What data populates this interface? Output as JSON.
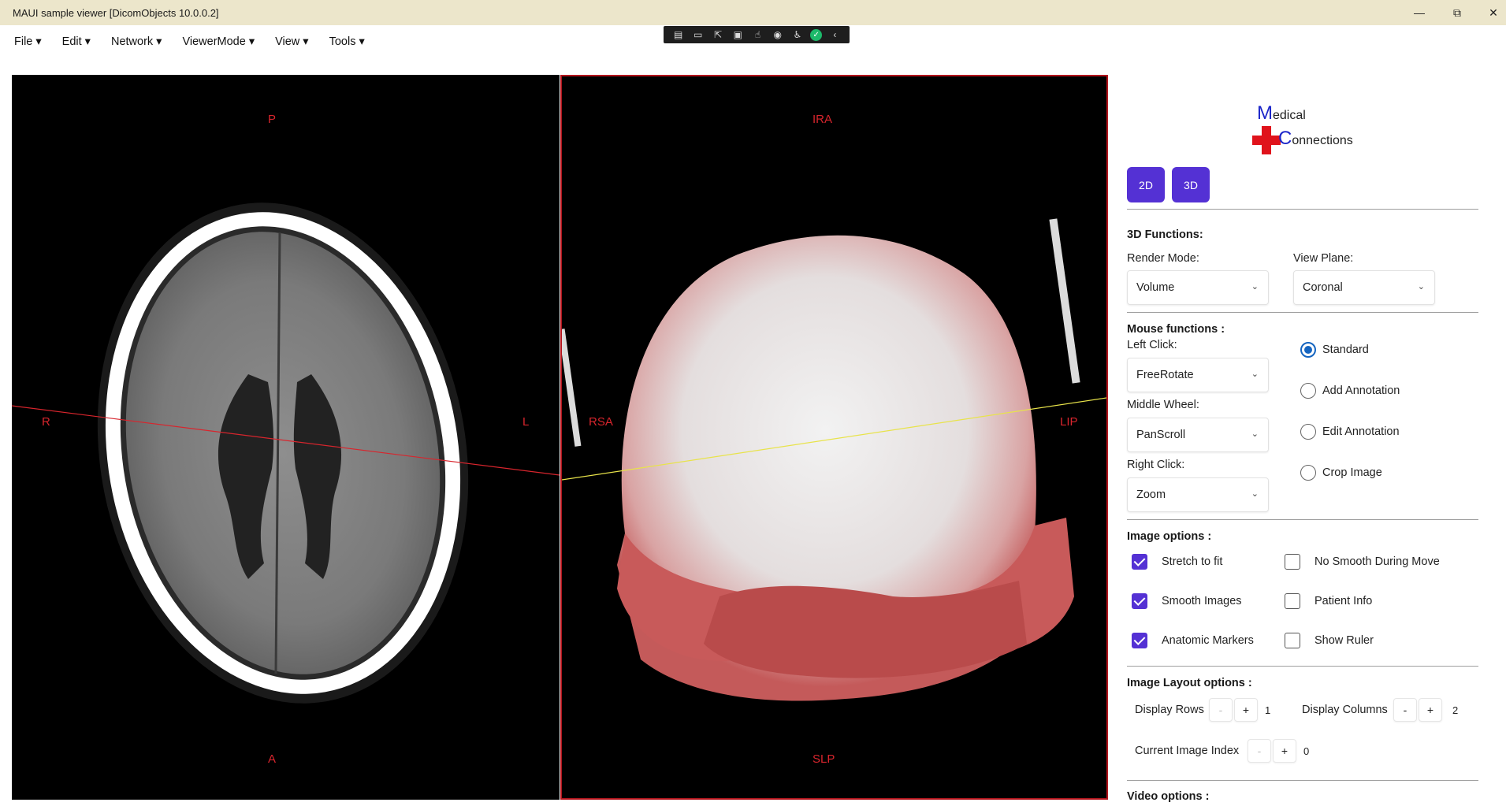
{
  "window": {
    "title": "MAUI sample viewer  [DicomObjects 10.0.0.2]",
    "minimize": "—",
    "restore": "⧉",
    "close": "✕"
  },
  "menu": [
    "File ▾",
    "Edit ▾",
    "Network ▾",
    "ViewerMode ▾",
    "View ▾",
    "Tools ▾"
  ],
  "floating_toolbar": {
    "icons": [
      "grid-icon",
      "camera-icon",
      "cursor-icon",
      "frame-icon",
      "touch-icon",
      "wave-icon",
      "accessibility-icon",
      "check-icon",
      "chevron-left-icon"
    ],
    "collapse": "‹"
  },
  "viewer_2d": {
    "markers": {
      "top": "P",
      "bottom": "A",
      "left": "R",
      "right": "L"
    }
  },
  "viewer_3d": {
    "markers": {
      "top": "IRA",
      "bottom": "SLP",
      "left": "RSA",
      "right": "LIP"
    }
  },
  "logo": {
    "line1_initial": "M",
    "line1_rest": "edical",
    "line2_initial": "C",
    "line2_rest": "onnections"
  },
  "panel": {
    "mode_buttons": [
      "2D",
      "3D"
    ],
    "functions_3d": {
      "heading": "3D Functions:",
      "render_mode_label": "Render Mode:",
      "render_mode_value": "Volume",
      "view_plane_label": "View Plane:",
      "view_plane_value": "Coronal"
    },
    "mouse": {
      "heading": "Mouse functions :",
      "left_label": "Left Click:",
      "left_value": "FreeRotate",
      "middle_label": "Middle Wheel:",
      "middle_value": "PanScroll",
      "right_label": "Right Click:",
      "right_value": "Zoom",
      "radios": [
        {
          "label": "Standard",
          "selected": true
        },
        {
          "label": "Add Annotation",
          "selected": false
        },
        {
          "label": "Edit Annotation",
          "selected": false
        },
        {
          "label": "Crop Image",
          "selected": false
        }
      ]
    },
    "image_options": {
      "heading": "Image options :",
      "checks": [
        {
          "label": "Stretch to fit",
          "checked": true
        },
        {
          "label": "No Smooth During Move",
          "checked": false
        },
        {
          "label": "Smooth Images",
          "checked": true
        },
        {
          "label": "Patient Info",
          "checked": false
        },
        {
          "label": "Anatomic Markers",
          "checked": true
        },
        {
          "label": "Show Ruler",
          "checked": false
        }
      ]
    },
    "layout": {
      "heading": "Image Layout options :",
      "rows_label": "Display Rows",
      "rows_value": "1",
      "cols_label": "Display Columns",
      "cols_value": "2",
      "index_label": "Current Image Index",
      "index_value": "0",
      "minus": "-",
      "plus": "+"
    },
    "video": {
      "heading": "Video options :"
    }
  },
  "colors": {
    "accent": "#5431d4",
    "marker": "#d8252d",
    "radio_selected": "#1565c0",
    "viewport_border": "#b3141c",
    "titlebar": "#ece6cb"
  }
}
